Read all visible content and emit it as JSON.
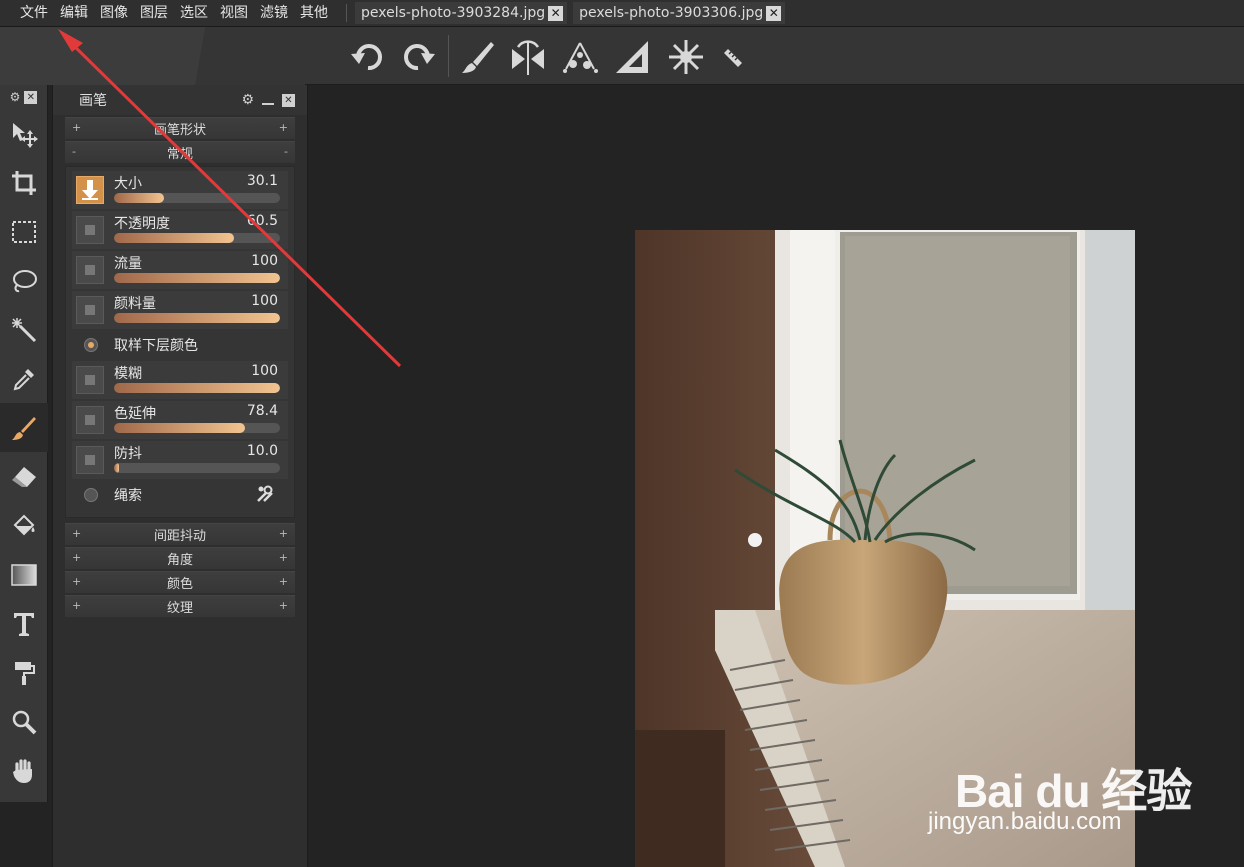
{
  "menu": [
    "文件",
    "编辑",
    "图像",
    "图层",
    "选区",
    "视图",
    "滤镜",
    "其他"
  ],
  "tabs": [
    {
      "label": "pexels-photo-3903284.jpg"
    },
    {
      "label": "pexels-photo-3903306.jpg"
    }
  ],
  "toolbar_icons": [
    "undo-icon",
    "redo-icon",
    "brush-icon",
    "symmetry-icon",
    "scatter-icon",
    "ruler-triangle-icon",
    "snowflake-icon",
    "ruler-icon"
  ],
  "tools": [
    "move-icon",
    "crop-icon",
    "marquee-icon",
    "lasso-icon",
    "magic-wand-icon",
    "eyedropper-icon",
    "brush-icon",
    "eraser-icon",
    "paint-bucket-icon",
    "gradient-icon",
    "text-icon",
    "paint-roller-icon",
    "zoom-icon",
    "hand-icon"
  ],
  "panel": {
    "title": "画笔",
    "sections_top": [
      {
        "sign": "+",
        "label": "画笔形状"
      },
      {
        "sign": "-",
        "label": "常规"
      }
    ],
    "props": [
      {
        "label": "大小",
        "value": "30.1",
        "fill": 30.1
      },
      {
        "label": "不透明度",
        "value": "60.5",
        "fill": 72
      },
      {
        "label": "流量",
        "value": "100",
        "fill": 100
      },
      {
        "label": "颜料量",
        "value": "100",
        "fill": 100
      }
    ],
    "sample_label": "取样下层颜色",
    "props2": [
      {
        "label": "模糊",
        "value": "100",
        "fill": 100
      },
      {
        "label": "色延伸",
        "value": "78.4",
        "fill": 79
      },
      {
        "label": "防抖",
        "value": "10.0",
        "fill": 3
      }
    ],
    "lasso_label": "绳索",
    "sections_bottom": [
      {
        "label": "间距抖动"
      },
      {
        "label": "角度"
      },
      {
        "label": "颜色"
      },
      {
        "label": "纹理"
      }
    ]
  },
  "watermark": {
    "logo": "Bai du 经验",
    "url": "jingyan.baidu.com"
  }
}
